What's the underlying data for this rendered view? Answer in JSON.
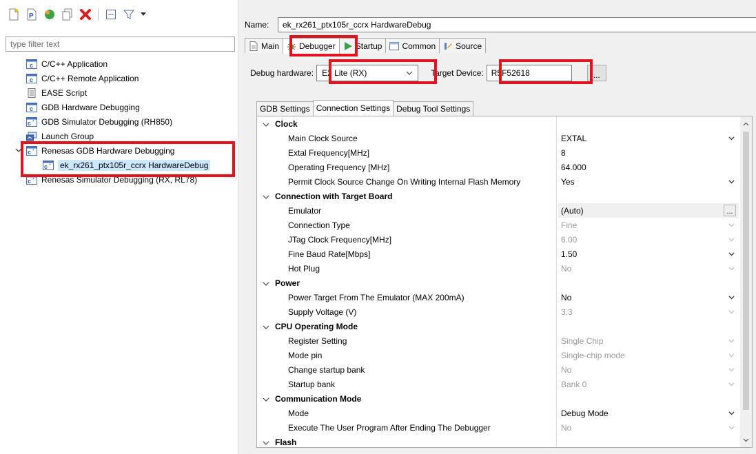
{
  "left": {
    "filter_placeholder": "type filter text",
    "tree": [
      {
        "label": "C/C++ Application",
        "icon": "c-app-icon"
      },
      {
        "label": "C/C++ Remote Application",
        "icon": "c-app-icon"
      },
      {
        "label": "EASE Script",
        "icon": "script-icon"
      },
      {
        "label": "GDB Hardware Debugging",
        "icon": "c-app-icon"
      },
      {
        "label": "GDB Simulator Debugging (RH850)",
        "icon": "c-debug-icon"
      },
      {
        "label": "Launch Group",
        "icon": "launch-group-icon"
      },
      {
        "label": "Renesas GDB Hardware Debugging",
        "icon": "c-debug-icon"
      },
      {
        "label": "ek_rx261_ptx105r_ccrx HardwareDebug",
        "icon": "c-debug-icon"
      },
      {
        "label": "Renesas Simulator Debugging (RX, RL78)",
        "icon": "c-debug-icon"
      }
    ]
  },
  "right": {
    "name_label": "Name:",
    "name_value": "ek_rx261_ptx105r_ccrx HardwareDebug",
    "tabs": [
      "Main",
      "Debugger",
      "Startup",
      "Common",
      "Source"
    ],
    "debug_hw_label": "Debug hardware:",
    "debug_hw_value": "E2 Lite (RX)",
    "target_label": "Target Device:",
    "target_value": "R5F52618",
    "browse_label": "...",
    "subtabs": [
      "GDB Settings",
      "Connection Settings",
      "Debug Tool Settings"
    ],
    "sections": [
      {
        "title": "Clock",
        "rows": [
          {
            "name": "Main Clock Source",
            "value": "EXTAL",
            "dd": true,
            "dim": false
          },
          {
            "name": "Extal Frequency[MHz]",
            "value": "8",
            "dd": false,
            "dim": false
          },
          {
            "name": "Operating Frequency [MHz]",
            "value": "64.000",
            "dd": false,
            "dim": false
          },
          {
            "name": "Permit Clock Source Change On Writing Internal Flash Memory",
            "value": "Yes",
            "dd": true,
            "dim": false
          }
        ]
      },
      {
        "title": "Connection with Target Board",
        "rows": [
          {
            "name": "Emulator",
            "value": "(Auto)",
            "ellipsis": true,
            "dim": false,
            "shaded": true
          },
          {
            "name": "Connection Type",
            "value": "Fine",
            "dd": true,
            "dim": true
          },
          {
            "name": "JTag Clock Frequency[MHz]",
            "value": "6.00",
            "dd": true,
            "dim": true
          },
          {
            "name": "Fine Baud Rate[Mbps]",
            "value": "1.50",
            "dd": true,
            "dim": false
          },
          {
            "name": "Hot Plug",
            "value": "No",
            "dd": true,
            "dim": true
          }
        ]
      },
      {
        "title": "Power",
        "rows": [
          {
            "name": "Power Target From The Emulator (MAX 200mA)",
            "value": "No",
            "dd": true,
            "dim": false
          },
          {
            "name": "Supply Voltage (V)",
            "value": "3.3",
            "dd": true,
            "dim": true
          }
        ]
      },
      {
        "title": "CPU Operating Mode",
        "rows": [
          {
            "name": "Register Setting",
            "value": "Single Chip",
            "dd": true,
            "dim": true
          },
          {
            "name": "Mode pin",
            "value": "Single-chip mode",
            "dd": true,
            "dim": true
          },
          {
            "name": "Change startup bank",
            "value": "No",
            "dd": true,
            "dim": true
          },
          {
            "name": "Startup bank",
            "value": "Bank 0",
            "dd": true,
            "dim": true
          }
        ]
      },
      {
        "title": "Communication Mode",
        "rows": [
          {
            "name": "Mode",
            "value": "Debug Mode",
            "dd": true,
            "dim": false
          },
          {
            "name": "Execute The User Program After Ending The Debugger",
            "value": "No",
            "dd": true,
            "dim": true
          }
        ]
      },
      {
        "title": "Flash",
        "rows": []
      }
    ]
  },
  "colors": {
    "highlight": "#e0141e",
    "selection": "#cce8ff"
  }
}
